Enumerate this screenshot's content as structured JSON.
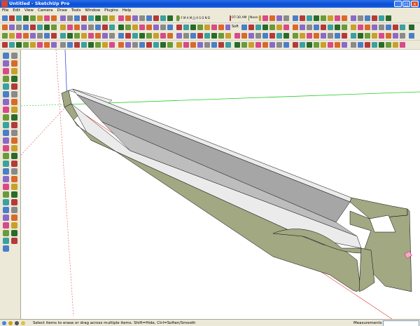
{
  "window": {
    "title": "Untitled - SketchUp Pro",
    "controls": [
      "_",
      "□",
      "×"
    ]
  },
  "menu": [
    "File",
    "Edit",
    "View",
    "Camera",
    "Draw",
    "Tools",
    "Window",
    "Plugins",
    "Help"
  ],
  "toolbar": {
    "time": "07:30 AM",
    "noon_label": "Noon",
    "soften_label": "Soft",
    "date_label": "J F M A M J J A S O N D"
  },
  "status": {
    "message": "Select items to erase or drag across multiple items. Shift=Hide, Ctrl=Soften/Smooth",
    "measurements_label": "Measurements",
    "measurements_value": ""
  },
  "colors": {
    "face_front": "#a1a882",
    "face_top": "#ecebec",
    "face_inner": "#a6a6a6",
    "red_axis": "#e65050",
    "green_axis": "#22cc22",
    "blue_axis": "#4444dd"
  }
}
